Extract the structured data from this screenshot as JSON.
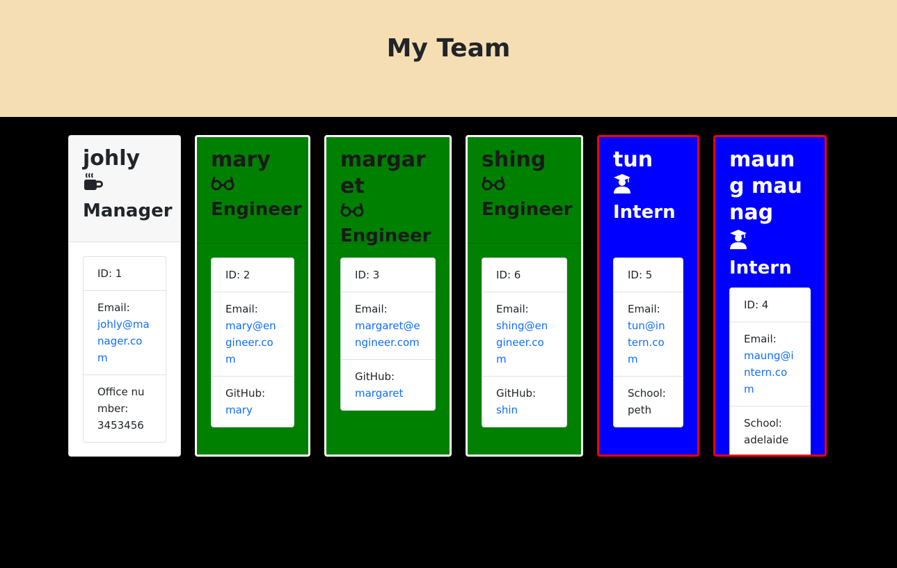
{
  "header": {
    "title": "My Team"
  },
  "members": [
    {
      "name": "johly",
      "role": "Manager",
      "icon": "coffee-icon",
      "id_text": "ID: 1",
      "email_label": "Email:",
      "email": "johly@manager.com",
      "extra_label": "Office number:",
      "extra_value": "3453456"
    },
    {
      "name": "mary",
      "role": "Engineer",
      "icon": "glasses-icon",
      "id_text": "ID: 2",
      "email_label": "Email:",
      "email": "mary@engineer.com",
      "extra_label": "GitHub:",
      "extra_value": "mary"
    },
    {
      "name": "margaret",
      "role": "Engineer",
      "icon": "glasses-icon",
      "id_text": "ID: 3",
      "email_label": "Email:",
      "email": "margaret@engineer.com",
      "extra_label": "GitHub:",
      "extra_value": "margaret"
    },
    {
      "name": "shing",
      "role": "Engineer",
      "icon": "glasses-icon",
      "id_text": "ID: 6",
      "email_label": "Email:",
      "email": "shing@engineer.com",
      "extra_label": "GitHub:",
      "extra_value": "shin"
    },
    {
      "name": "tun",
      "role": "Intern",
      "icon": "graduate-icon",
      "id_text": "ID: 5",
      "email_label": "Email:",
      "email": "tun@intern.com",
      "extra_label": "School:",
      "extra_value": "peth"
    },
    {
      "name": "maung maunag",
      "role": "Intern",
      "icon": "graduate-icon",
      "id_text": "ID: 4",
      "email_label": "Email:",
      "email": "maung@intern.com",
      "extra_label": "School:",
      "extra_value": "adelaide"
    }
  ],
  "colors": {
    "header_bg": "#f5deb3",
    "page_bg": "#000000",
    "engineer_bg": "#008000",
    "engineer_border": "#ffffff",
    "intern_bg": "#0000ff",
    "intern_border": "#ff0000",
    "link": "#0d6efd"
  }
}
